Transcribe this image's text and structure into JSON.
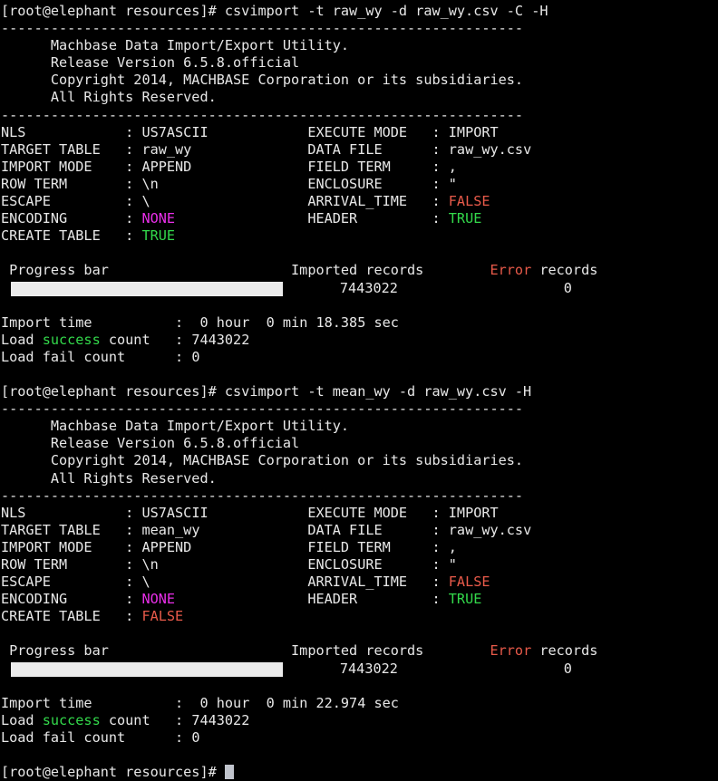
{
  "terminal": {
    "title": "root@elephant:~/resources",
    "colors": {
      "background": "#000000",
      "foreground": "#e8e8e8",
      "green": "#33d94b",
      "red": "#e85a4a",
      "magenta": "#ea2fea",
      "progress_fill": "#ebebeb",
      "cursor": "#c0c4cc"
    },
    "prompt": "[root@elephant resources]# ",
    "separator": "---------------------------------------------------------------",
    "banner": {
      "line1": "Machbase Data Import/Export Utility.",
      "line2": "Release Version 6.5.8.official",
      "line3": "Copyright 2014, MACHBASE Corporation or its subsidiaries.",
      "line4": "All Rights Reserved."
    },
    "progress": {
      "label": "Progress bar",
      "imported_label": "Imported records",
      "error_label_red": "Error",
      "error_label_rest": " records",
      "percent": 100
    },
    "summary_labels": {
      "import_time": "Import time",
      "load_success_prefix": "Load ",
      "load_success_word": "success",
      "load_success_suffix": " count",
      "load_fail": "Load fail count",
      "colon": ":"
    },
    "sessions": [
      {
        "command": "csvimport -t raw_wy -d raw_wy.csv -C -H",
        "params_left": [
          {
            "key": "NLS",
            "value": "US7ASCII",
            "color": "white"
          },
          {
            "key": "TARGET TABLE",
            "value": "raw_wy",
            "color": "white"
          },
          {
            "key": "IMPORT MODE",
            "value": "APPEND",
            "color": "white"
          },
          {
            "key": "ROW TERM",
            "value": "\\n",
            "color": "white"
          },
          {
            "key": "ESCAPE",
            "value": "\\",
            "color": "white"
          },
          {
            "key": "ENCODING",
            "value": "NONE",
            "color": "magenta"
          },
          {
            "key": "CREATE TABLE",
            "value": "TRUE",
            "color": "green"
          }
        ],
        "params_right": [
          {
            "key": "EXECUTE MODE",
            "value": "IMPORT",
            "color": "white"
          },
          {
            "key": "DATA FILE",
            "value": "raw_wy.csv",
            "color": "white"
          },
          {
            "key": "FIELD TERM",
            "value": ",",
            "color": "white"
          },
          {
            "key": "ENCLOSURE",
            "value": "\"",
            "color": "white"
          },
          {
            "key": "ARRIVAL_TIME",
            "value": "FALSE",
            "color": "red"
          },
          {
            "key": "HEADER",
            "value": "TRUE",
            "color": "green"
          }
        ],
        "imported_records": "7443022",
        "error_records": "0",
        "import_time_value": "0 hour  0 min 18.385 sec",
        "load_success_count": "7443022",
        "load_fail_count": "0"
      },
      {
        "command": "csvimport -t mean_wy -d raw_wy.csv -H",
        "params_left": [
          {
            "key": "NLS",
            "value": "US7ASCII",
            "color": "white"
          },
          {
            "key": "TARGET TABLE",
            "value": "mean_wy",
            "color": "white"
          },
          {
            "key": "IMPORT MODE",
            "value": "APPEND",
            "color": "white"
          },
          {
            "key": "ROW TERM",
            "value": "\\n",
            "color": "white"
          },
          {
            "key": "ESCAPE",
            "value": "\\",
            "color": "white"
          },
          {
            "key": "ENCODING",
            "value": "NONE",
            "color": "magenta"
          },
          {
            "key": "CREATE TABLE",
            "value": "FALSE",
            "color": "red"
          }
        ],
        "params_right": [
          {
            "key": "EXECUTE MODE",
            "value": "IMPORT",
            "color": "white"
          },
          {
            "key": "DATA FILE",
            "value": "raw_wy.csv",
            "color": "white"
          },
          {
            "key": "FIELD TERM",
            "value": ",",
            "color": "white"
          },
          {
            "key": "ENCLOSURE",
            "value": "\"",
            "color": "white"
          },
          {
            "key": "ARRIVAL_TIME",
            "value": "FALSE",
            "color": "red"
          },
          {
            "key": "HEADER",
            "value": "TRUE",
            "color": "green"
          }
        ],
        "imported_records": "7443022",
        "error_records": "0",
        "import_time_value": "0 hour  0 min 22.974 sec",
        "load_success_count": "7443022",
        "load_fail_count": "0"
      }
    ],
    "final_prompt": "[root@elephant resources]# "
  }
}
